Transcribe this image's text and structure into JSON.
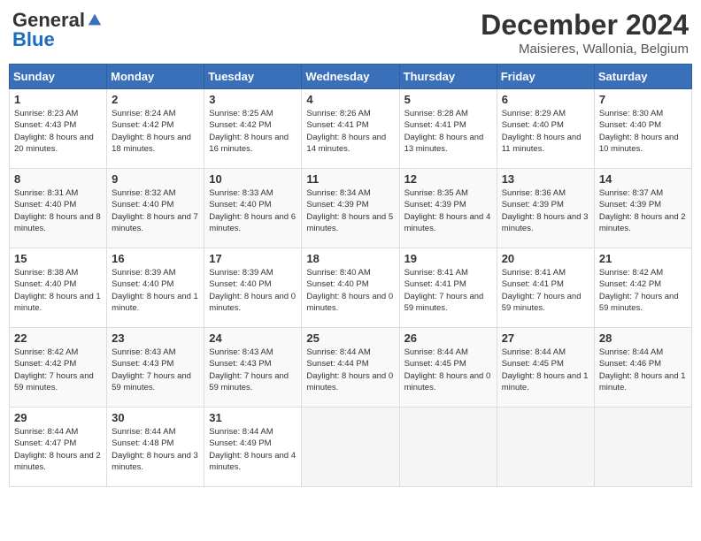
{
  "logo": {
    "general": "General",
    "blue": "Blue"
  },
  "header": {
    "month": "December 2024",
    "location": "Maisieres, Wallonia, Belgium"
  },
  "weekdays": [
    "Sunday",
    "Monday",
    "Tuesday",
    "Wednesday",
    "Thursday",
    "Friday",
    "Saturday"
  ],
  "weeks": [
    [
      {
        "day": "1",
        "sunrise": "8:23 AM",
        "sunset": "4:43 PM",
        "daylight": "8 hours and 20 minutes."
      },
      {
        "day": "2",
        "sunrise": "8:24 AM",
        "sunset": "4:42 PM",
        "daylight": "8 hours and 18 minutes."
      },
      {
        "day": "3",
        "sunrise": "8:25 AM",
        "sunset": "4:42 PM",
        "daylight": "8 hours and 16 minutes."
      },
      {
        "day": "4",
        "sunrise": "8:26 AM",
        "sunset": "4:41 PM",
        "daylight": "8 hours and 14 minutes."
      },
      {
        "day": "5",
        "sunrise": "8:28 AM",
        "sunset": "4:41 PM",
        "daylight": "8 hours and 13 minutes."
      },
      {
        "day": "6",
        "sunrise": "8:29 AM",
        "sunset": "4:40 PM",
        "daylight": "8 hours and 11 minutes."
      },
      {
        "day": "7",
        "sunrise": "8:30 AM",
        "sunset": "4:40 PM",
        "daylight": "8 hours and 10 minutes."
      }
    ],
    [
      {
        "day": "8",
        "sunrise": "8:31 AM",
        "sunset": "4:40 PM",
        "daylight": "8 hours and 8 minutes."
      },
      {
        "day": "9",
        "sunrise": "8:32 AM",
        "sunset": "4:40 PM",
        "daylight": "8 hours and 7 minutes."
      },
      {
        "day": "10",
        "sunrise": "8:33 AM",
        "sunset": "4:40 PM",
        "daylight": "8 hours and 6 minutes."
      },
      {
        "day": "11",
        "sunrise": "8:34 AM",
        "sunset": "4:39 PM",
        "daylight": "8 hours and 5 minutes."
      },
      {
        "day": "12",
        "sunrise": "8:35 AM",
        "sunset": "4:39 PM",
        "daylight": "8 hours and 4 minutes."
      },
      {
        "day": "13",
        "sunrise": "8:36 AM",
        "sunset": "4:39 PM",
        "daylight": "8 hours and 3 minutes."
      },
      {
        "day": "14",
        "sunrise": "8:37 AM",
        "sunset": "4:39 PM",
        "daylight": "8 hours and 2 minutes."
      }
    ],
    [
      {
        "day": "15",
        "sunrise": "8:38 AM",
        "sunset": "4:40 PM",
        "daylight": "8 hours and 1 minute."
      },
      {
        "day": "16",
        "sunrise": "8:39 AM",
        "sunset": "4:40 PM",
        "daylight": "8 hours and 1 minute."
      },
      {
        "day": "17",
        "sunrise": "8:39 AM",
        "sunset": "4:40 PM",
        "daylight": "8 hours and 0 minutes."
      },
      {
        "day": "18",
        "sunrise": "8:40 AM",
        "sunset": "4:40 PM",
        "daylight": "8 hours and 0 minutes."
      },
      {
        "day": "19",
        "sunrise": "8:41 AM",
        "sunset": "4:41 PM",
        "daylight": "7 hours and 59 minutes."
      },
      {
        "day": "20",
        "sunrise": "8:41 AM",
        "sunset": "4:41 PM",
        "daylight": "7 hours and 59 minutes."
      },
      {
        "day": "21",
        "sunrise": "8:42 AM",
        "sunset": "4:42 PM",
        "daylight": "7 hours and 59 minutes."
      }
    ],
    [
      {
        "day": "22",
        "sunrise": "8:42 AM",
        "sunset": "4:42 PM",
        "daylight": "7 hours and 59 minutes."
      },
      {
        "day": "23",
        "sunrise": "8:43 AM",
        "sunset": "4:43 PM",
        "daylight": "7 hours and 59 minutes."
      },
      {
        "day": "24",
        "sunrise": "8:43 AM",
        "sunset": "4:43 PM",
        "daylight": "7 hours and 59 minutes."
      },
      {
        "day": "25",
        "sunrise": "8:44 AM",
        "sunset": "4:44 PM",
        "daylight": "8 hours and 0 minutes."
      },
      {
        "day": "26",
        "sunrise": "8:44 AM",
        "sunset": "4:45 PM",
        "daylight": "8 hours and 0 minutes."
      },
      {
        "day": "27",
        "sunrise": "8:44 AM",
        "sunset": "4:45 PM",
        "daylight": "8 hours and 1 minute."
      },
      {
        "day": "28",
        "sunrise": "8:44 AM",
        "sunset": "4:46 PM",
        "daylight": "8 hours and 1 minute."
      }
    ],
    [
      {
        "day": "29",
        "sunrise": "8:44 AM",
        "sunset": "4:47 PM",
        "daylight": "8 hours and 2 minutes."
      },
      {
        "day": "30",
        "sunrise": "8:44 AM",
        "sunset": "4:48 PM",
        "daylight": "8 hours and 3 minutes."
      },
      {
        "day": "31",
        "sunrise": "8:44 AM",
        "sunset": "4:49 PM",
        "daylight": "8 hours and 4 minutes."
      },
      null,
      null,
      null,
      null
    ]
  ]
}
